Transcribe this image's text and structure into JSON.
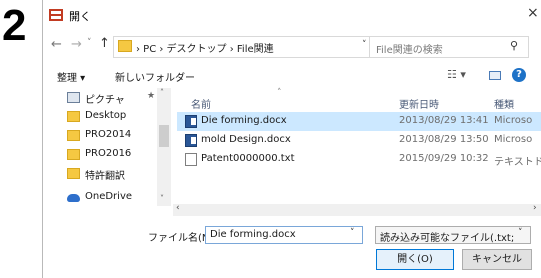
{
  "step_number": "2",
  "window": {
    "title": "開く",
    "close_glyph": "×"
  },
  "nav": {
    "back_glyph": "←",
    "forward_glyph": "→",
    "recent_glyph": "˅",
    "up_glyph": "↑",
    "address_path": "› PC › デスクトップ › File関連",
    "address_dropdown_glyph": "˅",
    "refresh_glyph": "↻",
    "search_placeholder": "File関連の検索",
    "search_glyph": "⚲"
  },
  "toolbar": {
    "organize_label": "整理 ▾",
    "new_folder_label": "新しいフォルダー",
    "view_glyph": "☷ ▾",
    "help_glyph": "?"
  },
  "sidebar": {
    "items": [
      {
        "label": "ピクチャ",
        "icon": "pictures-icon",
        "pinned": "★"
      },
      {
        "label": "Desktop",
        "icon": "folder-icon"
      },
      {
        "label": "PRO2014",
        "icon": "folder-icon"
      },
      {
        "label": "PRO2016",
        "icon": "folder-icon"
      },
      {
        "label": "特許翻訳",
        "icon": "folder-icon"
      },
      {
        "label": "OneDrive",
        "icon": "cloud-icon"
      }
    ],
    "scroll_up": "˄",
    "scroll_down": "˅"
  },
  "file_list": {
    "columns": [
      "名前",
      "更新日時",
      "種類"
    ],
    "sort_glyph": "˄",
    "rows": [
      {
        "name": "Die forming.docx",
        "modified": "2013/08/29 13:41",
        "type": "Microso",
        "icon": "word-doc-icon",
        "selected": true
      },
      {
        "name": "mold Design.docx",
        "modified": "2013/08/29 13:50",
        "type": "Microso",
        "icon": "word-doc-icon",
        "selected": false
      },
      {
        "name": "Patent0000000.txt",
        "modified": "2015/09/29 10:32",
        "type": "テキストド",
        "icon": "text-file-icon",
        "selected": false
      }
    ],
    "hscroll_left": "‹",
    "hscroll_right": "›"
  },
  "footer": {
    "filename_label": "ファイル名(N):",
    "filename_value": "Die forming.docx",
    "filename_dd": "˅",
    "filter_value": "読み込み可能なファイル(.txt;.txt;.h",
    "filter_dd": "˅",
    "open_label": "開く(O)",
    "cancel_label": "キャンセル"
  }
}
